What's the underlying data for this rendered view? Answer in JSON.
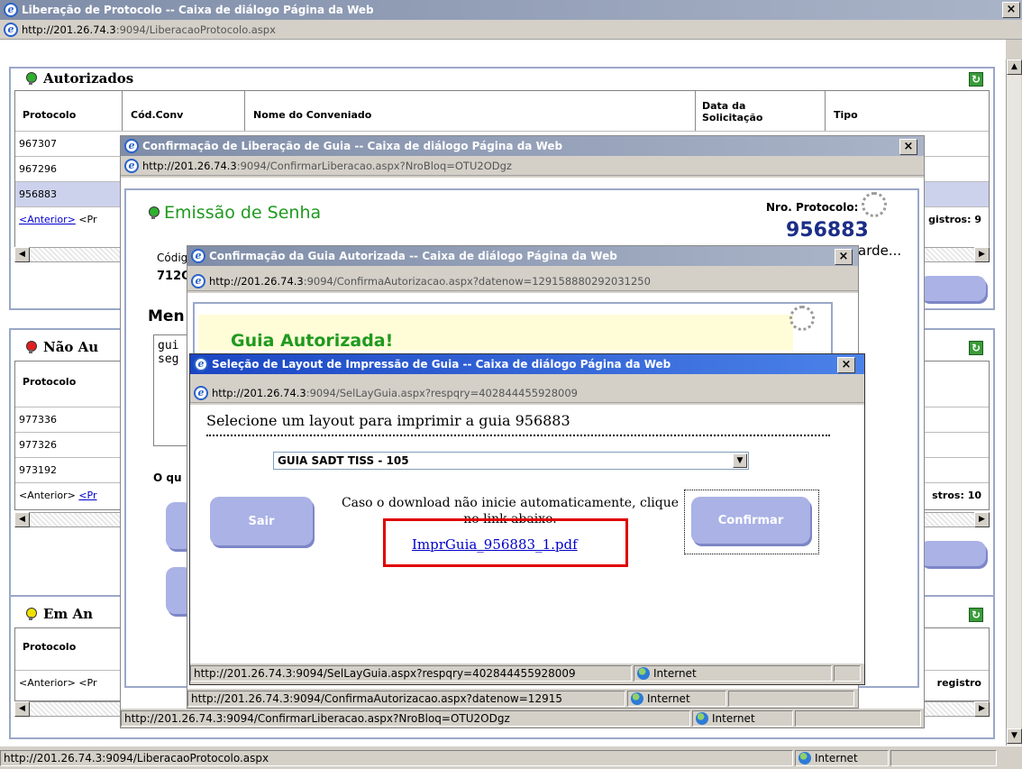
{
  "main_window": {
    "title": "Liberação de Protocolo -- Caixa de diálogo Página da Web",
    "url_host": "http://201.26.74.3",
    "url_path": ":9094/LiberacaoProtocolo.aspx",
    "status_url": "http://201.26.74.3:9094/LiberacaoProtocolo.aspx",
    "status_zone": "Internet",
    "close": "×"
  },
  "autorizados": {
    "title": "Autorizados",
    "columns": [
      "Protocolo",
      "Cód.Conv",
      "Nome do Conveniado",
      "Data da Solicitação",
      "Tipo"
    ],
    "rows": [
      "967307",
      "967296",
      "956883"
    ],
    "pager_prev": "<Anterior>",
    "pager_rest": "<Pr",
    "registros": "gistros: 9"
  },
  "nao_autorizados": {
    "title": "Não Au",
    "column": "Protocolo",
    "rows": [
      "977336",
      "977326",
      "973192"
    ],
    "pager_prev": "<Anterior>",
    "pager_rest": "<Pr",
    "registros": "stros: 10"
  },
  "em_analise": {
    "title": "Em An",
    "column": "Protocolo",
    "pager": "<Anterior> <Pr",
    "registros": "registro"
  },
  "dialog1": {
    "title": "Confirmação de Liberação de Guia -- Caixa de diálogo Página da Web",
    "url_host": "http://201.26.74.3",
    "url_path": ":9094/ConfirmarLiberacao.aspx?NroBloq=OTU2ODgz",
    "heading": "Emissão de Senha",
    "nro_label": "Nro. Protocolo:",
    "nro_value": "956883",
    "aguarde": "arde...",
    "codigo_label": "Códig",
    "codigo_value": "712C",
    "mensagem_label": "Men",
    "mensagem_text": "gui\nseg",
    "o_que_label": "O qu",
    "status_url": "http://201.26.74.3:9094/ConfirmarLiberacao.aspx?NroBloq=OTU2ODgz",
    "status_zone": "Internet",
    "close": "×"
  },
  "dialog2": {
    "title": "Confirmação da Guia Autorizada -- Caixa de diálogo Página da Web",
    "url_host": "http://201.26.74.3",
    "url_path": ":9094/ConfirmaAutorizacao.aspx?datenow=129158880292031250",
    "heading": "Guia Autorizada!",
    "status_url": "http://201.26.74.3:9094/ConfirmaAutorizacao.aspx?datenow=12915",
    "status_zone": "Internet",
    "close": "×"
  },
  "dialog3": {
    "title": "Seleção de Layout de Impressão de Guia -- Caixa de diálogo Página da Web",
    "url_host": "http://201.26.74.3",
    "url_path": ":9094/SelLayGuia.aspx?respqry=402844455928009",
    "prompt": "Selecione um layout para imprimir a guia 956883",
    "select_value": "GUIA SADT TISS - 105",
    "sair": "Sair",
    "confirmar": "Confirmar",
    "download_text": "Caso o download não inicie automaticamente, clique no link abaixo.",
    "download_link": "ImprGuia_956883_1.pdf",
    "status_url": "http://201.26.74.3:9094/SelLayGuia.aspx?respqry=402844455928009",
    "status_zone": "Internet",
    "close": "×"
  },
  "colors": {
    "title_active": "#2f5fd0",
    "title_inactive": "#7f8da8",
    "highlight": "#e00000",
    "button": "#aab2e6",
    "heading_green": "#1f9a1f"
  },
  "icons": [
    "ie-icon",
    "globe-icon",
    "bulb-icon",
    "refresh-icon",
    "close-icon",
    "dropdown-arrow-icon",
    "spinner-icon"
  ]
}
